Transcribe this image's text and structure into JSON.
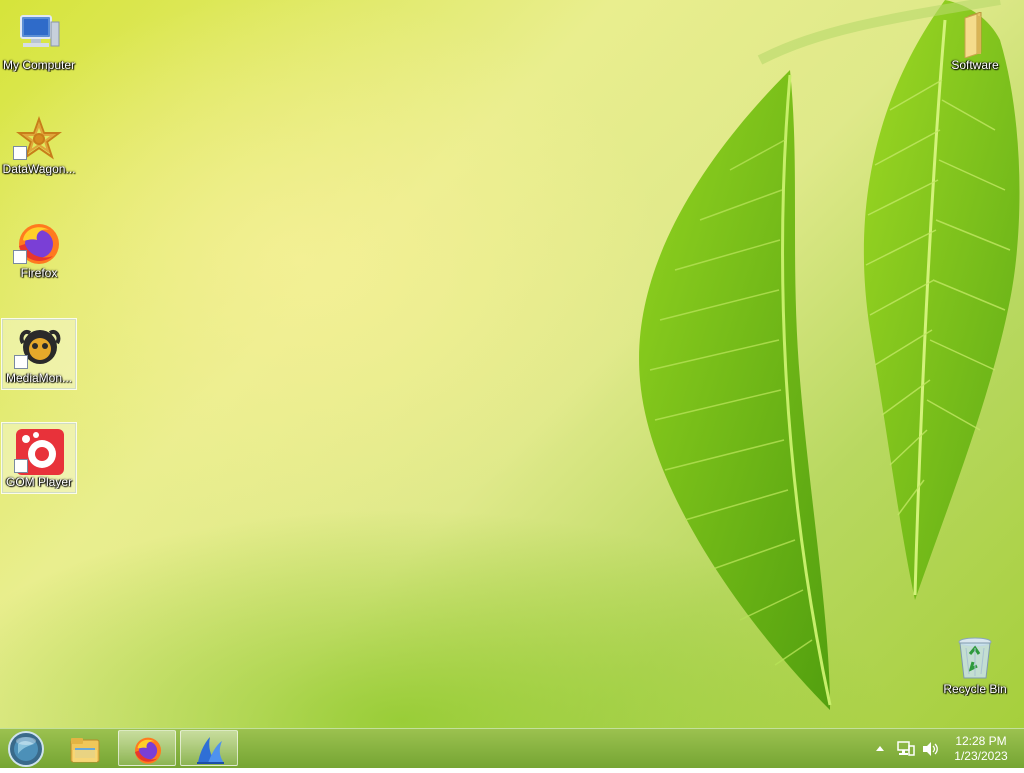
{
  "desktop": {
    "icons": [
      {
        "label": "My Computer",
        "icon": "computer-icon"
      },
      {
        "label": "DataWagon...",
        "icon": "datawagon-icon"
      },
      {
        "label": "Firefox",
        "icon": "firefox-icon"
      },
      {
        "label": "MediaMon...",
        "icon": "mediamonkey-icon"
      },
      {
        "label": "GOM Player",
        "icon": "gom-player-icon"
      },
      {
        "label": "Software",
        "icon": "folder-icon"
      },
      {
        "label": "Recycle Bin",
        "icon": "recycle-bin-icon"
      }
    ]
  },
  "taskbar": {
    "start_icon": "start-orb-icon",
    "pinned": [
      {
        "name": "File Explorer",
        "icon": "folder-explorer-icon"
      },
      {
        "name": "Firefox",
        "icon": "firefox-icon"
      },
      {
        "name": "App",
        "icon": "blue-sail-icon"
      }
    ],
    "tray": {
      "show_hidden_icon": "chevron-up-icon",
      "network_icon": "network-icon",
      "volume_icon": "speaker-icon",
      "time": "12:28 PM",
      "date": "1/23/2023"
    }
  },
  "colors": {
    "wallpaper_light": "#e9ee8e",
    "wallpaper_green": "#a6cf3c",
    "taskbar": "#86b03a"
  }
}
